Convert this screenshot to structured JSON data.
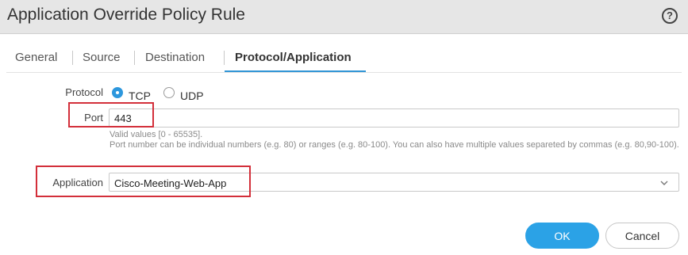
{
  "dialog": {
    "title": "Application Override Policy Rule",
    "help_glyph": "?"
  },
  "tabs": [
    {
      "label": "General",
      "active": false
    },
    {
      "label": "Source",
      "active": false
    },
    {
      "label": "Destination",
      "active": false
    },
    {
      "label": "Protocol/Application",
      "active": true
    }
  ],
  "form": {
    "protocol": {
      "label": "Protocol",
      "options": [
        {
          "label": "TCP",
          "selected": true
        },
        {
          "label": "UDP",
          "selected": false
        }
      ]
    },
    "port": {
      "label": "Port",
      "value": "443",
      "hint_line1": "Valid values [0 - 65535].",
      "hint_line2": "Port number can be individual numbers (e.g. 80) or ranges (e.g. 80-100). You can also have multiple values separeted by commas (e.g. 80,90-100)."
    },
    "application": {
      "label": "Application",
      "value": "Cisco-Meeting-Web-App"
    }
  },
  "buttons": {
    "ok": "OK",
    "cancel": "Cancel"
  },
  "colors": {
    "accent": "#2ba2e6",
    "highlight": "#d32f3a",
    "titlebar": "#e6e6e6"
  },
  "icons": {
    "help": "help-circle-icon",
    "dropdown": "chevron-down-icon"
  }
}
